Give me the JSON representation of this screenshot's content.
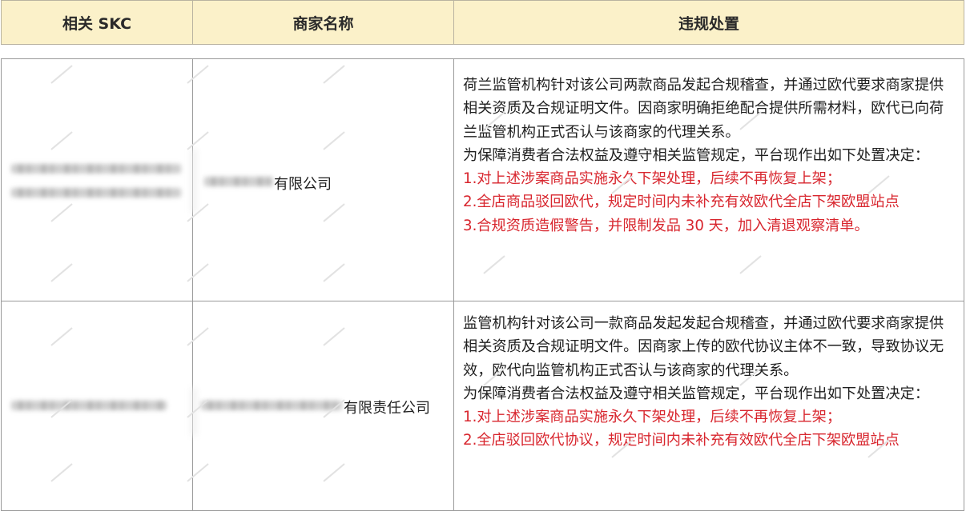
{
  "header": {
    "col_skc": "相关 SKC",
    "col_merchant": "商家名称",
    "col_action": "违规处置"
  },
  "rows": [
    {
      "merchant_suffix": "有限公司",
      "lines": [
        "荷兰监管机构针对该公司两款商品发起合规稽查，并通过欧代要求商家提供相关资质及合规证明文件。因商家明确拒绝配合提供所需材料，欧代已向荷兰监管机构正式否认与该商家的代理关系。",
        "为保障消费者合法权益及遵守相关监管规定，平台现作出如下处置决定："
      ],
      "actions": [
        "1.对上述涉案商品实施永久下架处理，后续不再恢复上架；",
        "2.全店商品驳回欧代，规定时间内未补充有效欧代全店下架欧盟站点",
        "3.合规资质造假警告，并限制发品 30 天，加入清退观察清单。"
      ]
    },
    {
      "merchant_suffix": "有限责任公司",
      "lines": [
        "监管机构针对该公司一款商品发起发起合规稽查，并通过欧代要求商家提供相关资质及合规证明文件。因商家上传的欧代协议主体不一致，导致协议无效，欧代向监管机构正式否认与该商家的代理关系。",
        "为保障消费者合法权益及遵守相关监管规定，平台现作出如下处置决定："
      ],
      "actions": [
        "1.对上述涉案商品实施永久下架处理，后续不再恢复上架；",
        "2.全店驳回欧代协议，规定时间内未补充有效欧代全店下架欧盟站点"
      ]
    }
  ],
  "colors": {
    "header_bg": "#fbf1c9",
    "action_red": "#d8262e",
    "border": "#9a9a9a"
  }
}
